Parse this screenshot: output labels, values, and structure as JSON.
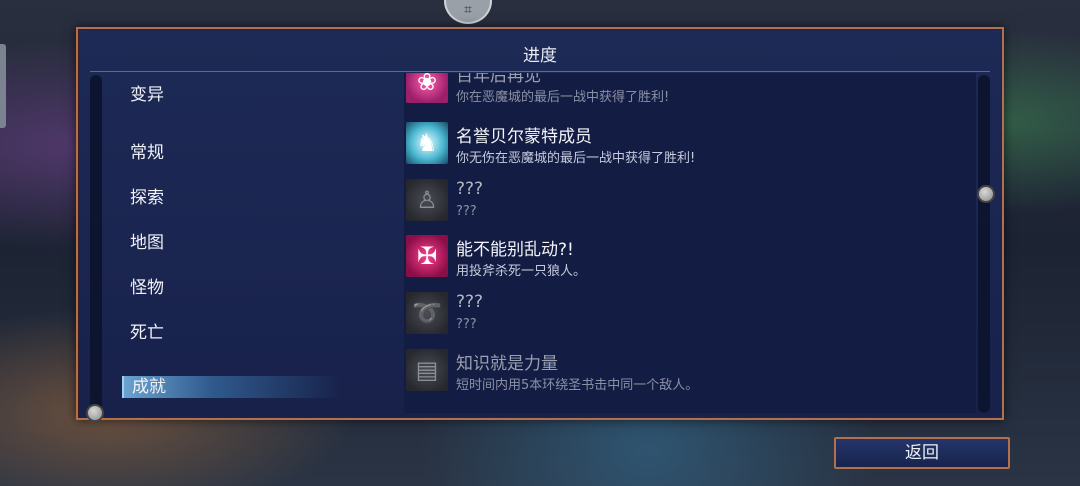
{
  "header": {
    "title": "进度"
  },
  "top_badge": {
    "icon": "controller-icon",
    "glyph": "⌗"
  },
  "categories": [
    {
      "label": "变异"
    },
    {
      "label": "常规"
    },
    {
      "label": "探索"
    },
    {
      "label": "地图"
    },
    {
      "label": "怪物"
    },
    {
      "label": "死亡"
    },
    {
      "label": "成就",
      "selected": true
    }
  ],
  "achievements": [
    {
      "name": "百年后再见",
      "desc": "你在恶魔城的最后一战中获得了胜利!",
      "icon": "lotus-icon",
      "glyph": "❀",
      "state": "partial"
    },
    {
      "name": "名誉贝尔蒙特成员",
      "desc": "你无伤在恶魔城的最后一战中获得了胜利!",
      "icon": "winged-skull-icon",
      "glyph": "♞",
      "state": "unlocked"
    },
    {
      "name": "???",
      "desc": "???",
      "icon": "cat-silhouette-icon",
      "glyph": "♙",
      "state": "locked"
    },
    {
      "name": "能不能别乱动?!",
      "desc": "用投斧杀死一只狼人。",
      "icon": "axe-wolf-icon",
      "glyph": "✠",
      "state": "unlocked"
    },
    {
      "name": "???",
      "desc": "???",
      "icon": "whip-silhouette-icon",
      "glyph": "➰",
      "state": "locked"
    },
    {
      "name": "知识就是力量",
      "desc": "短时间内用5本环绕圣书击中同一个敌人。",
      "icon": "book-icon",
      "glyph": "▤",
      "state": "dim"
    }
  ],
  "buttons": {
    "back": "返回"
  }
}
